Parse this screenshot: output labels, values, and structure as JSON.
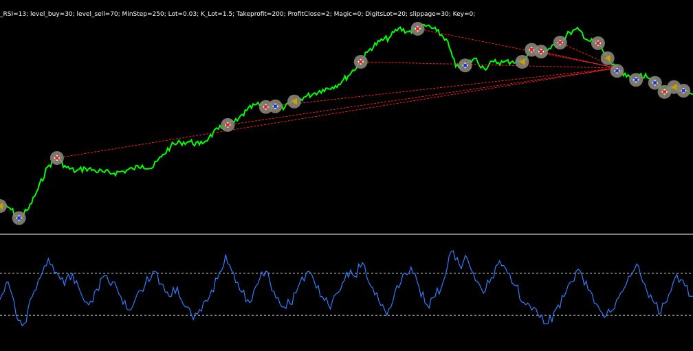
{
  "header": {
    "parameters": "_RSI=13; level_buy=30; level_sell=70; MinStep=250; Lot=0.03; K_Lot=1.5; Takeprofit=200; ProfitClose=2; Magic=0; DigitsLot=20; slippage=30; Key=0;"
  },
  "colors": {
    "background": "#000000",
    "price_line": "#00ff00",
    "rsi_line": "#2f7fff",
    "level_line": "#ffffff",
    "separator": "#ffffff",
    "order_line": "#ff2020",
    "buy_arrow": "#1a2fff",
    "sell_arrow": "#ff1a1a",
    "marker_halo": "#8a8378",
    "close_marker": "#c8a000"
  },
  "chart_data": [
    {
      "type": "line",
      "title": "",
      "series": [
        {
          "values": [
            40,
            37,
            20,
            35,
            68,
            105,
            120,
            104,
            98,
            103,
            99,
            96,
            95,
            98,
            102,
            108,
            103,
            122,
            140,
            146,
            147,
            142,
            154,
            168,
            175,
            182,
            199,
            209,
            205,
            206,
            204,
            214,
            221,
            227,
            234,
            238,
            247,
            262,
            280,
            302,
            314,
            320,
            336,
            330,
            335,
            340,
            331,
            318,
            272,
            274,
            286,
            269,
            280,
            279,
            281,
            280,
            300,
            297,
            302,
            312,
            329,
            333,
            315,
            311,
            286,
            265,
            255,
            250,
            260,
            245,
            230,
            238,
            232,
            226
          ]
        }
      ],
      "grid": false
    },
    {
      "type": "line",
      "title": "",
      "ylim": [
        0,
        100
      ],
      "levels": [
        70,
        30
      ],
      "series": [
        {
          "values": [
            45,
            62,
            30,
            22,
            48,
            66,
            84,
            71,
            58,
            70,
            52,
            40,
            55,
            68,
            62,
            48,
            35,
            50,
            59,
            72,
            60,
            48,
            57,
            38,
            26,
            34,
            48,
            65,
            88,
            70,
            52,
            42,
            60,
            72,
            53,
            38,
            41,
            57,
            70,
            62,
            48,
            36,
            52,
            71,
            67,
            80,
            58,
            44,
            30,
            52,
            69,
            76,
            57,
            40,
            48,
            62,
            91,
            78,
            84,
            63,
            51,
            66,
            82,
            70,
            58,
            42,
            35,
            28,
            22,
            36,
            48,
            62,
            72,
            54,
            41,
            28,
            35,
            51,
            67,
            79,
            60,
            44,
            32,
            50,
            69,
            58,
            48
          ]
        }
      ],
      "grid": false
    }
  ]
}
